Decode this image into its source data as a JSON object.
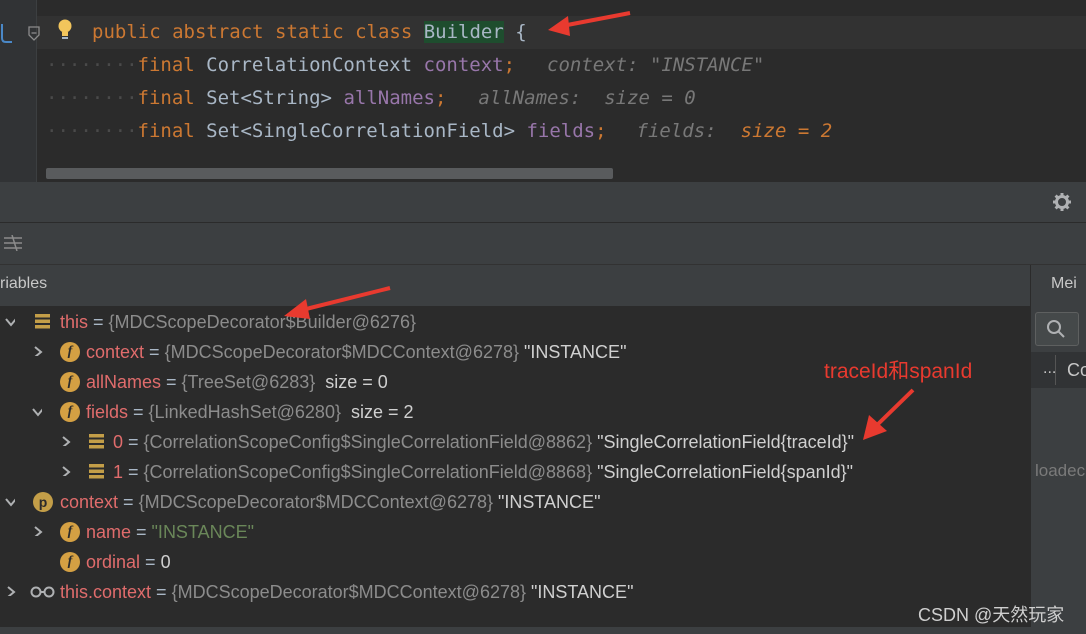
{
  "editor": {
    "line1": {
      "kw": "public abstract static class ",
      "name": "Builder",
      "brace": " {"
    },
    "line2": {
      "kw": "final ",
      "type": "CorrelationContext ",
      "field": "context",
      "semi": ";",
      "hint": "context: \"INSTANCE\""
    },
    "line3": {
      "kw": "final ",
      "type": "Set<String> ",
      "field": "allNames",
      "semi": ";",
      "hint": "allNames:  size = 0"
    },
    "line4": {
      "kw": "final ",
      "type": "Set<SingleCorrelationField> ",
      "field": "fields",
      "semi": ";",
      "hint_label": "fields:",
      "hint_value": "size = 2"
    }
  },
  "debugger": {
    "variables_tab": "riables",
    "right_tab": "Mei",
    "right_col_label": "Co",
    "right_ellipsis": "...",
    "right_status": "loadec"
  },
  "variables": [
    {
      "name": "this",
      "eq": " = ",
      "ref": "{MDCScopeDecorator$Builder@6276}",
      "val": ""
    },
    {
      "name": "context",
      "eq": " = ",
      "ref": "{MDCScopeDecorator$MDCContext@6278}",
      "val": " \"INSTANCE\""
    },
    {
      "name": "allNames",
      "eq": " = ",
      "ref": "{TreeSet@6283}",
      "val": "  size = 0"
    },
    {
      "name": "fields",
      "eq": " = ",
      "ref": "{LinkedHashSet@6280}",
      "val": "  size = 2"
    },
    {
      "name": "0",
      "eq": " = ",
      "ref": "{CorrelationScopeConfig$SingleCorrelationField@8862}",
      "val": " \"SingleCorrelationField{traceId}\""
    },
    {
      "name": "1",
      "eq": " = ",
      "ref": "{CorrelationScopeConfig$SingleCorrelationField@8868}",
      "val": " \"SingleCorrelationField{spanId}\""
    },
    {
      "name": "context",
      "eq": " = ",
      "ref": "{MDCScopeDecorator$MDCContext@6278}",
      "val": " \"INSTANCE\""
    },
    {
      "name": "name",
      "eq": " = ",
      "ref": "",
      "val": "\"INSTANCE\""
    },
    {
      "name": "ordinal",
      "eq": " = ",
      "ref": "",
      "val": "0"
    },
    {
      "name": "this.context",
      "eq": " = ",
      "ref": "{MDCScopeDecorator$MDCContext@6278}",
      "val": " \"INSTANCE\""
    }
  ],
  "annotation": "traceId和spanId",
  "watermark": "CSDN @天然玩家",
  "colors": {
    "arrow": "#e83a2f",
    "highlight": "#1e4d2e"
  }
}
